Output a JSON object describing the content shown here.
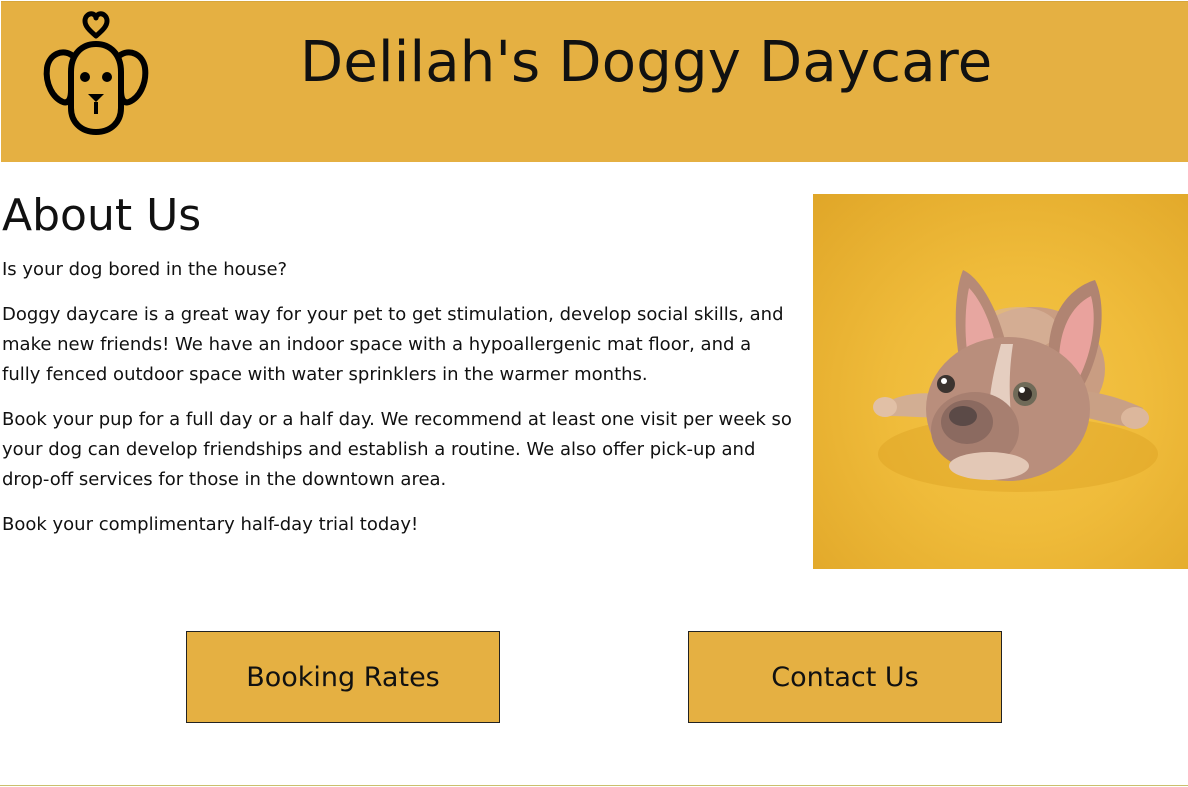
{
  "header": {
    "title": "Delilah's Doggy Daycare",
    "logo_icon": "dog-heart-icon",
    "background_color": "#e5b042"
  },
  "about": {
    "heading": "About Us",
    "paragraphs": [
      "Is your dog bored in the house?",
      "Doggy daycare is a great way for your pet to get stimulation, develop social skills, and make new friends! We have an indoor space with a hypoallergenic mat floor, and a fully fenced outdoor space with water sprinklers in the warmer months.",
      "Book your pup for a full day or a half day. We recommend at least one visit per week so your dog can develop friendships and establish a routine. We also offer pick-up and drop-off services for those in the downtown area.",
      "Book your complimentary half-day trial today!"
    ]
  },
  "photo": {
    "subject": "puppy-photo"
  },
  "buttons": {
    "booking_label": "Booking Rates",
    "contact_label": "Contact Us",
    "color": "#e5b042"
  }
}
